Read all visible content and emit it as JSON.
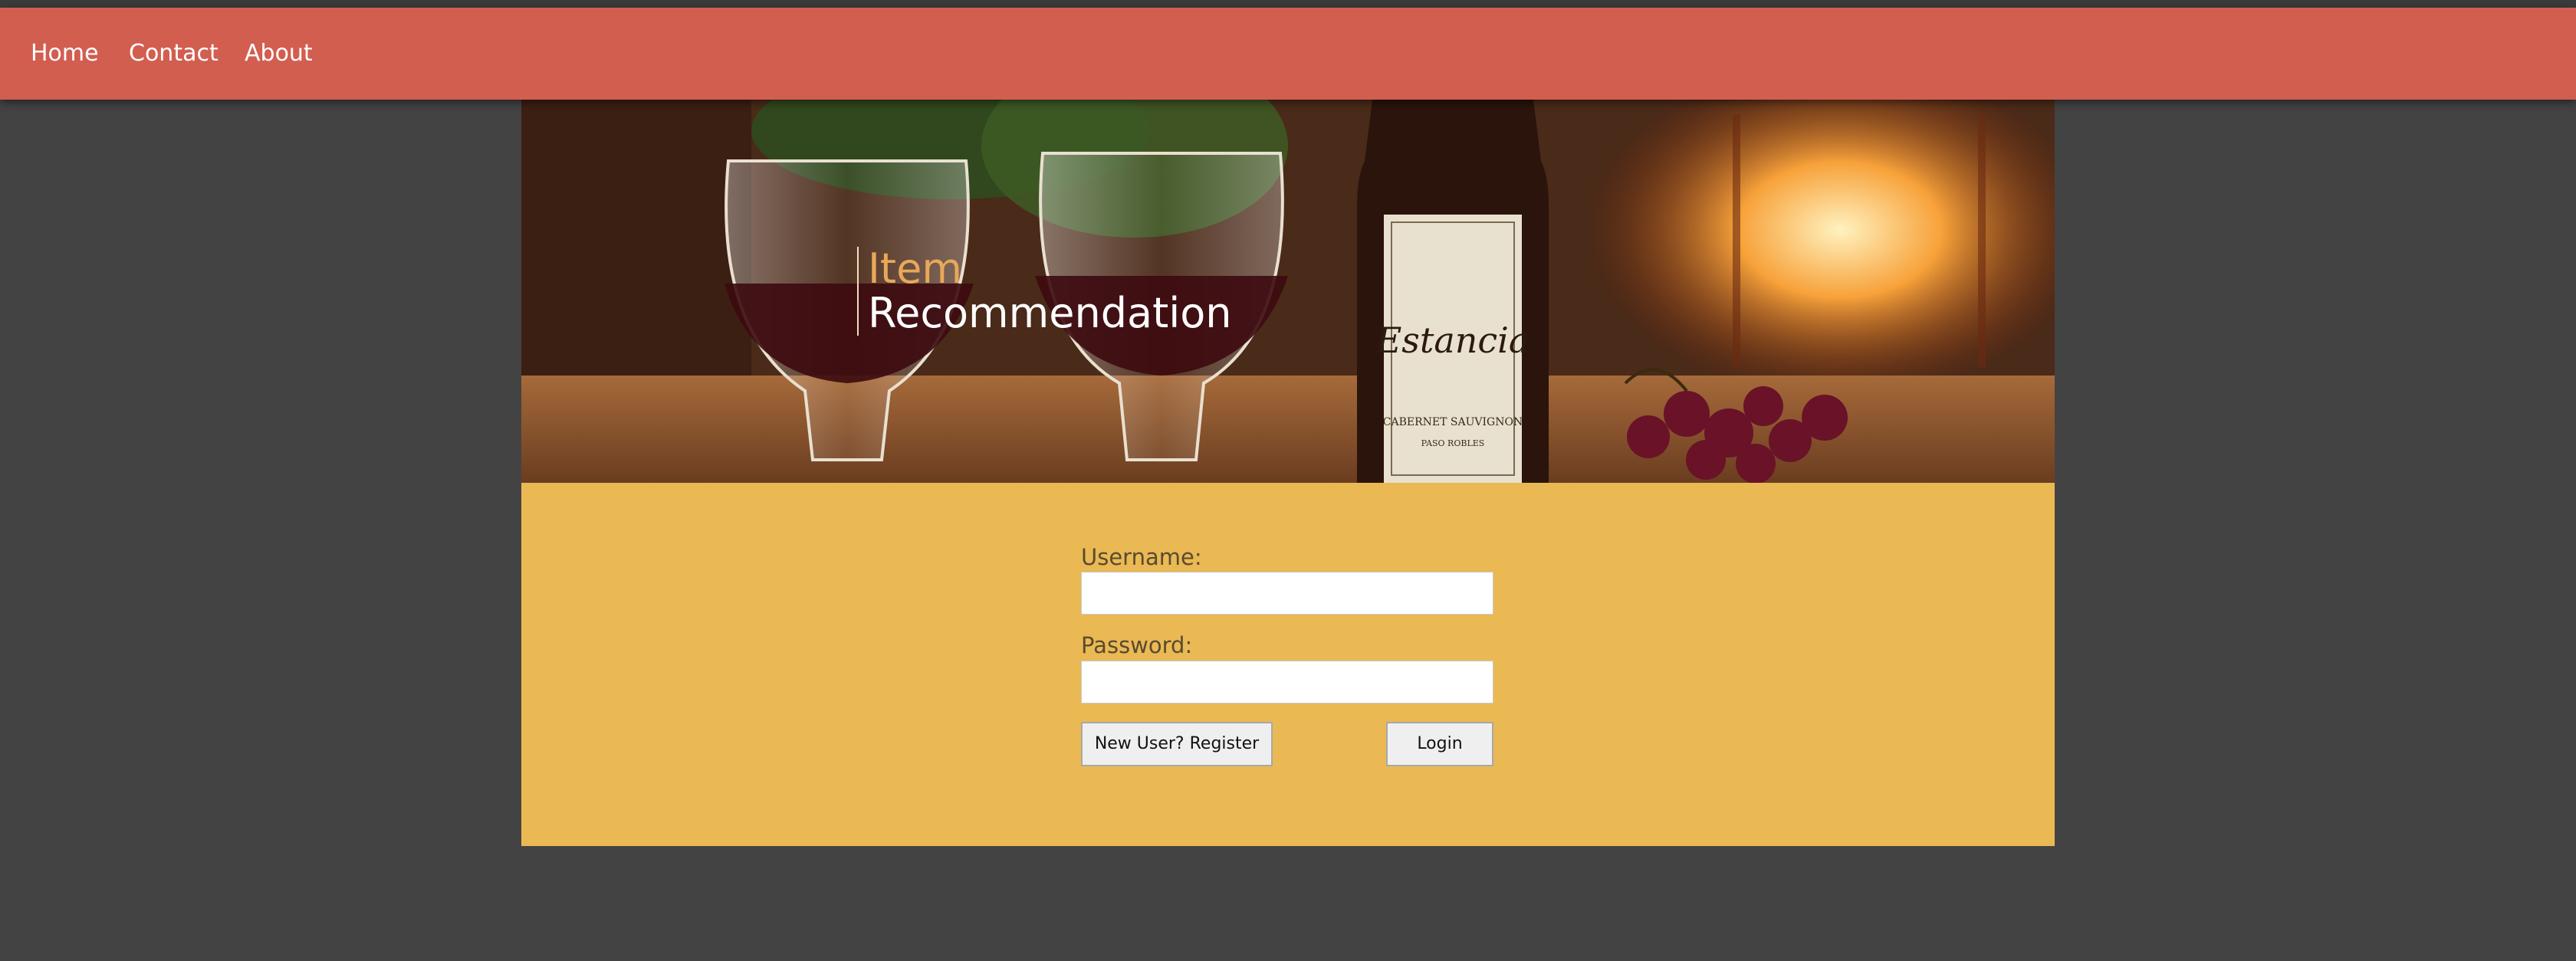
{
  "nav": {
    "items": [
      {
        "label": "Home"
      },
      {
        "label": "Contact"
      },
      {
        "label": "About"
      }
    ],
    "bar_color": "#d25e50"
  },
  "banner": {
    "title_line1": "Item",
    "title_line2": "Recommendation",
    "bottle_label": "Estancia",
    "bottle_sublabel": "CABERNET SAUVIGNON",
    "bottle_sublabel2": "PASO ROBLES"
  },
  "login": {
    "username_label": "Username:",
    "username_value": "",
    "password_label": "Password:",
    "password_value": "",
    "register_label": "New User? Register",
    "login_label": "Login",
    "panel_color": "#eab954"
  }
}
